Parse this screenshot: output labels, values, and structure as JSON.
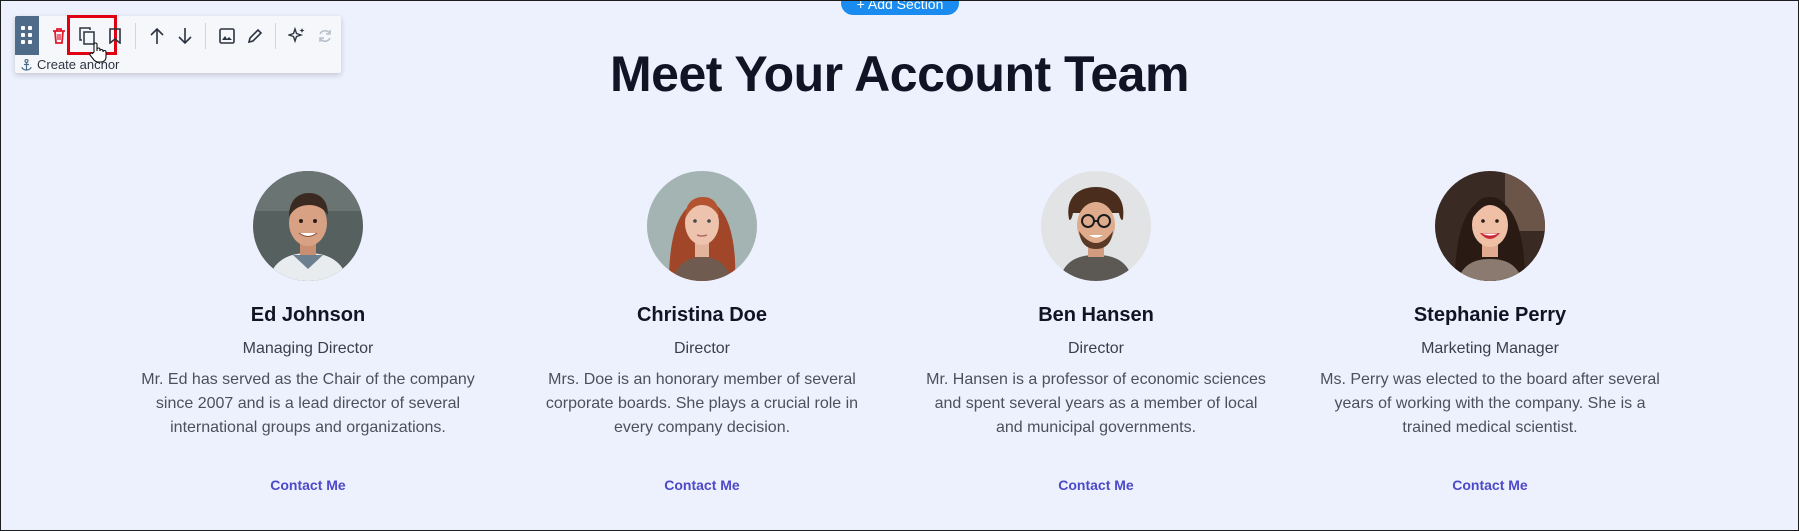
{
  "add_section": {
    "label": "+ Add Section"
  },
  "title": "Meet Your Account Team",
  "toolbar": {
    "anchor_label": "Create anchor",
    "icons": [
      "drag-handle-icon",
      "trash-icon",
      "duplicate-icon",
      "bookmark-icon",
      "arrow-up-icon",
      "arrow-down-icon",
      "image-icon",
      "pencil-icon",
      "sparkles-icon",
      "refresh-icon"
    ]
  },
  "team": [
    {
      "name": "Ed Johnson",
      "role": "Managing Director",
      "bio": "Mr. Ed has served as the Chair of the company since 2007 and is a lead director of several international groups and organizations.",
      "contact": "Contact Me"
    },
    {
      "name": "Christina Doe",
      "role": "Director",
      "bio": "Mrs. Doe is an honorary member of several corporate boards. She plays a crucial role in every company decision.",
      "contact": "Contact Me"
    },
    {
      "name": "Ben Hansen",
      "role": "Director",
      "bio": "Mr. Hansen is a professor of economic sciences and spent several years as a member of local and municipal governments.",
      "contact": "Contact Me"
    },
    {
      "name": "Stephanie Perry",
      "role": "Marketing Manager",
      "bio": "Ms. Perry was elected to the board after several years of working with the company. She is a trained medical scientist.",
      "contact": "Contact Me"
    }
  ],
  "colors": {
    "background": "#edf1fd",
    "accent_link": "#4d49c9",
    "add_section": "#1a8cf0",
    "highlight": "#e00012"
  }
}
